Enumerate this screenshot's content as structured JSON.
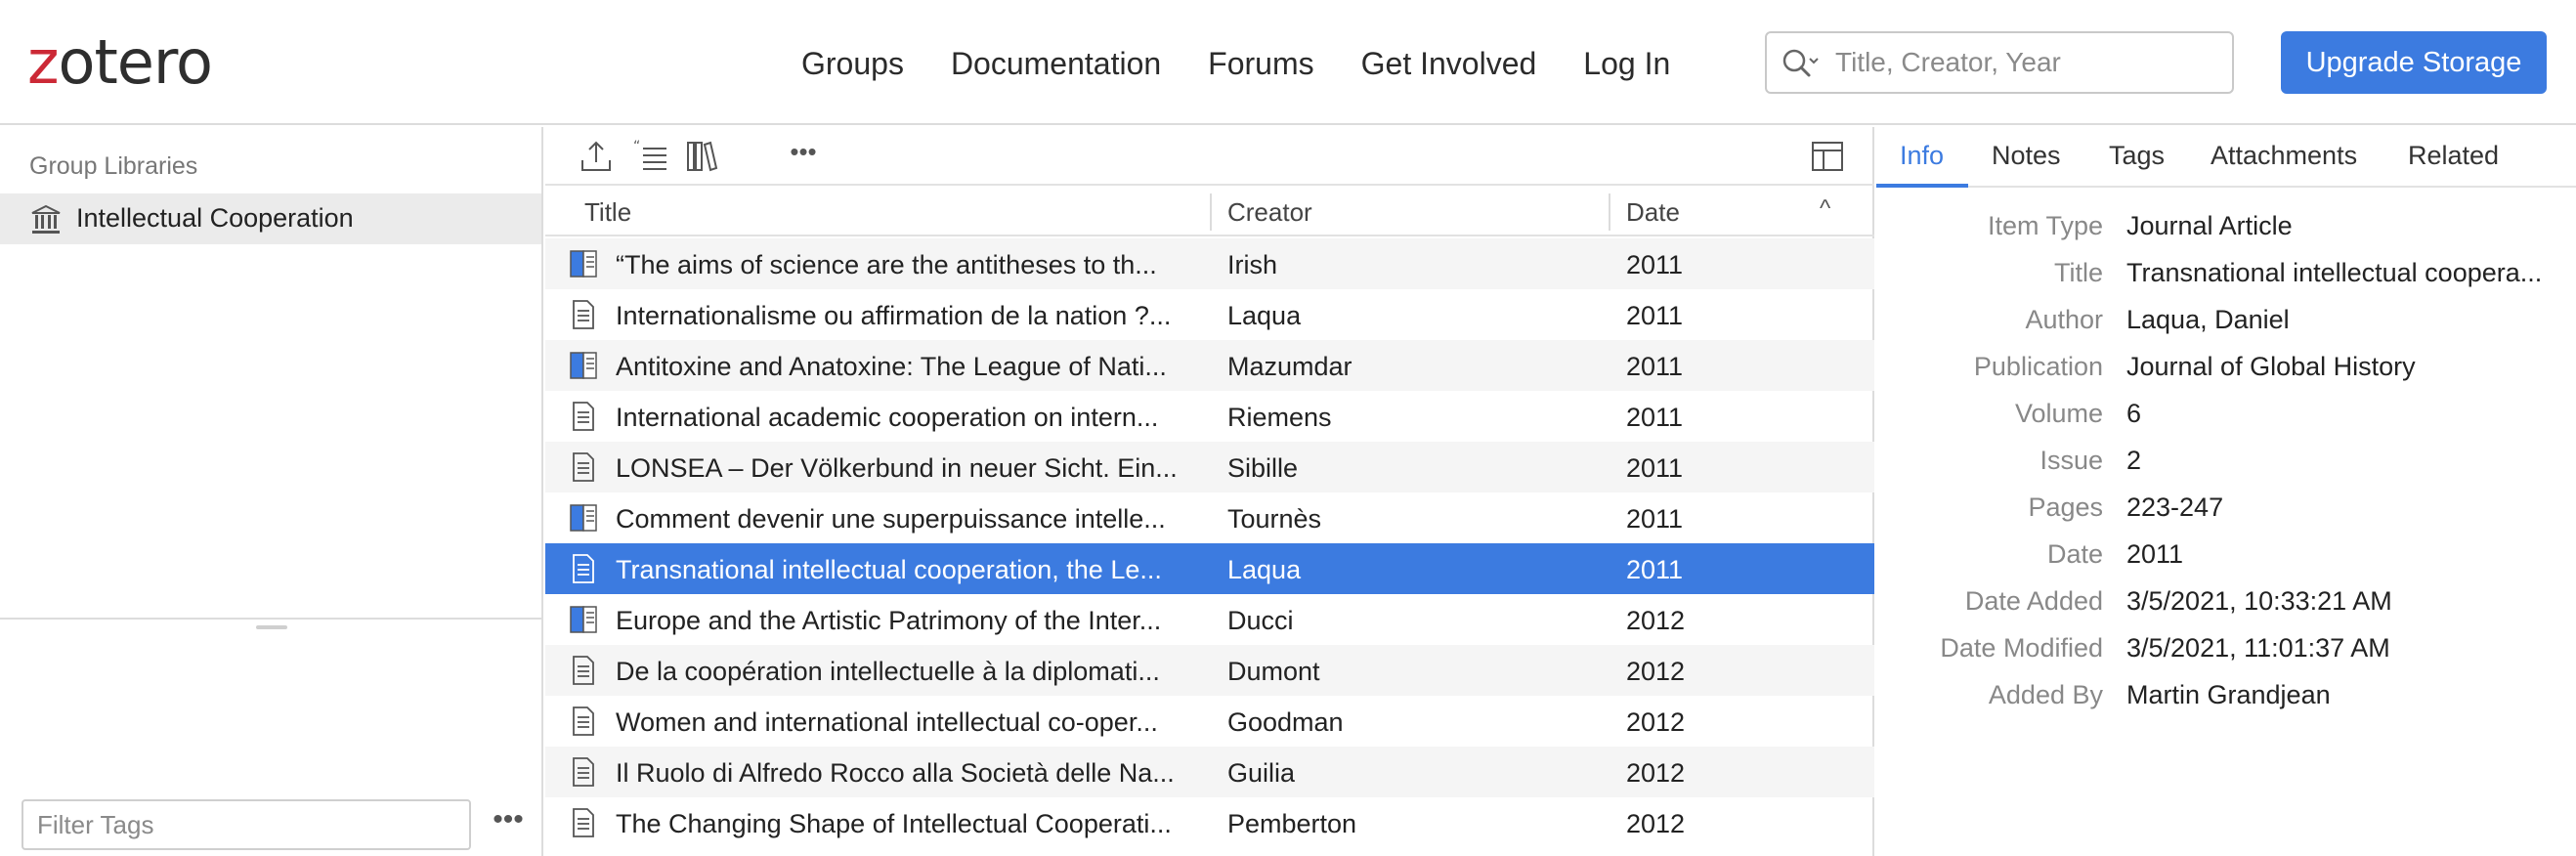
{
  "header": {
    "logo": {
      "z": "z",
      "rest": "otero"
    },
    "nav": [
      "Groups",
      "Documentation",
      "Forums",
      "Get Involved",
      "Log In"
    ],
    "search_placeholder": "Title, Creator, Year",
    "upgrade_label": "Upgrade Storage"
  },
  "left": {
    "section_title": "Group Libraries",
    "library": "Intellectual Cooperation",
    "tag_filter_placeholder": "Filter Tags",
    "tag_more": "•••"
  },
  "middle": {
    "more_label": "•••",
    "columns": {
      "title": "Title",
      "creator": "Creator",
      "date": "Date",
      "sort_indicator": "^"
    },
    "rows": [
      {
        "type": "book",
        "title": "“The aims of science are the antitheses to th...",
        "creator": "Irish",
        "date": "2011"
      },
      {
        "type": "document",
        "title": "Internationalisme ou affirmation de la nation ?...",
        "creator": "Laqua",
        "date": "2011"
      },
      {
        "type": "book",
        "title": "Antitoxine and Anatoxine: The League of Nati...",
        "creator": "Mazumdar",
        "date": "2011"
      },
      {
        "type": "document",
        "title": "International academic cooperation on intern...",
        "creator": "Riemens",
        "date": "2011"
      },
      {
        "type": "document",
        "title": "LONSEA – Der Völkerbund in neuer Sicht. Ein...",
        "creator": "Sibille",
        "date": "2011"
      },
      {
        "type": "book",
        "title": "Comment devenir une superpuissance intelle...",
        "creator": "Tournès",
        "date": "2011"
      },
      {
        "type": "document",
        "title": "Transnational intellectual cooperation, the Le...",
        "creator": "Laqua",
        "date": "2011",
        "selected": true
      },
      {
        "type": "book",
        "title": "Europe and the Artistic Patrimony of the Inter...",
        "creator": "Ducci",
        "date": "2012"
      },
      {
        "type": "document",
        "title": "De la coopération intellectuelle à la diplomati...",
        "creator": "Dumont",
        "date": "2012"
      },
      {
        "type": "document",
        "title": "Women and international intellectual co-oper...",
        "creator": "Goodman",
        "date": "2012"
      },
      {
        "type": "document",
        "title": "Il Ruolo di Alfredo Rocco alla Società delle Na...",
        "creator": "Guilia",
        "date": "2012"
      },
      {
        "type": "document",
        "title": "The Changing Shape of Intellectual Cooperati...",
        "creator": "Pemberton",
        "date": "2012"
      }
    ]
  },
  "right": {
    "tabs": [
      "Info",
      "Notes",
      "Tags",
      "Attachments",
      "Related"
    ],
    "active_tab": "Info",
    "fields": [
      {
        "k": "Item Type",
        "v": "Journal Article"
      },
      {
        "k": "Title",
        "v": "Transnational intellectual coopera..."
      },
      {
        "k": "Author",
        "v": "Laqua, Daniel"
      },
      {
        "k": "Publication",
        "v": "Journal of Global History"
      },
      {
        "k": "Volume",
        "v": "6"
      },
      {
        "k": "Issue",
        "v": "2"
      },
      {
        "k": "Pages",
        "v": "223-247"
      },
      {
        "k": "Date",
        "v": "2011"
      },
      {
        "k": "Date Added",
        "v": "3/5/2021, 10:33:21 AM"
      },
      {
        "k": "Date Modified",
        "v": "3/5/2021, 11:01:37 AM"
      },
      {
        "k": "Added By",
        "v": "Martin Grandjean"
      }
    ]
  },
  "colors": {
    "accent": "#3c7be0",
    "logo_z": "#cc2936",
    "selected_row": "#3c7be0"
  }
}
